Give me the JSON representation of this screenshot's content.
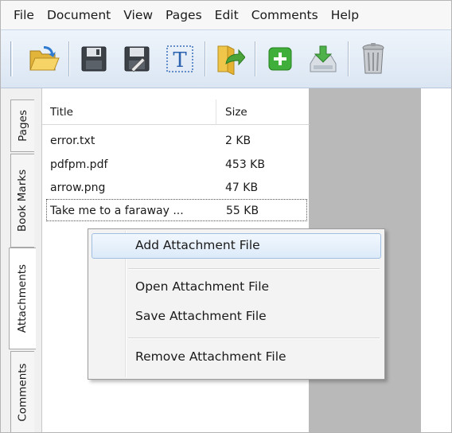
{
  "menu": [
    "File",
    "Document",
    "View",
    "Pages",
    "Edit",
    "Comments",
    "Help"
  ],
  "toolbar": {
    "icons": [
      "open-folder-icon",
      "save-icon",
      "save-as-icon",
      "text-tool-icon",
      "export-icon",
      "add-icon",
      "download-icon",
      "trash-icon"
    ]
  },
  "side_tabs": {
    "pages": "Pages",
    "bookmarks": "Book Marks",
    "attachments": "Attachments",
    "comments": "Comments"
  },
  "attachments": {
    "columns": {
      "title": "Title",
      "size": "Size"
    },
    "rows": [
      {
        "name": "error.txt",
        "size": "2 KB"
      },
      {
        "name": "pdfpm.pdf",
        "size": "453 KB"
      },
      {
        "name": "arrow.png",
        "size": "47 KB"
      },
      {
        "name": "Take me to a faraway ...",
        "size": "55 KB"
      }
    ]
  },
  "context_menu": {
    "add": "Add Attachment File",
    "open": "Open Attachment File",
    "save": "Save Attachment File",
    "remove": "Remove Attachment File"
  }
}
